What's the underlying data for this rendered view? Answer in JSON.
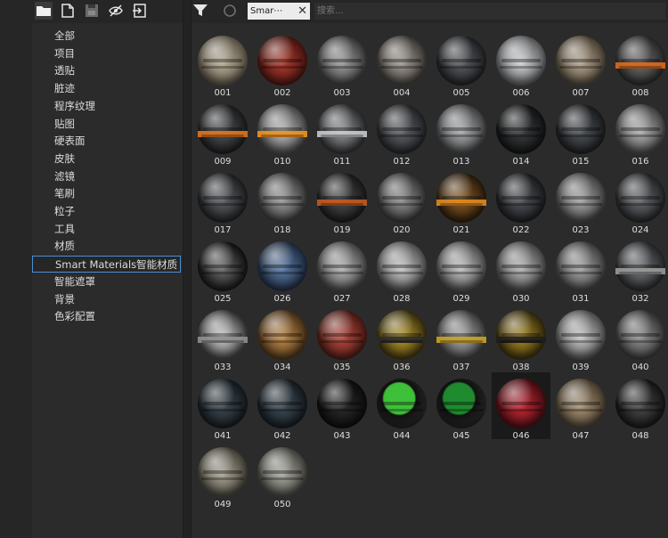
{
  "toolbar": {
    "icons": [
      "folder-icon",
      "new-file-icon",
      "save-icon",
      "hide-icon",
      "import-icon"
    ]
  },
  "sidebar": {
    "categories": [
      "全部",
      "项目",
      "透贴",
      "脏迹",
      "程序纹理",
      "贴图",
      "硬表面",
      "皮肤",
      "滤镜",
      "笔刷",
      "粒子",
      "工具",
      "材质",
      "Smart Materials智能材质",
      "智能遮罩",
      "背景",
      "色彩配置"
    ],
    "selected_index": 13
  },
  "topbar": {
    "filter_icon": "filter-icon",
    "reset_icon": "reset-icon",
    "tag_label": "Smar⋯",
    "tag_close": "✕",
    "search_placeholder": "搜索..."
  },
  "materials": [
    {
      "id": "001",
      "c1": "#b7ad96",
      "c2": "#5e5547"
    },
    {
      "id": "002",
      "c1": "#b03a2e",
      "c2": "#4a1510"
    },
    {
      "id": "003",
      "c1": "#9c9c9c",
      "c2": "#3d3d3d"
    },
    {
      "id": "004",
      "c1": "#a09a92",
      "c2": "#403c38"
    },
    {
      "id": "005",
      "c1": "#5a5d61",
      "c2": "#1f2123"
    },
    {
      "id": "006",
      "c1": "#cfd1d2",
      "c2": "#5b5d5f"
    },
    {
      "id": "007",
      "c1": "#b3a58f",
      "c2": "#4f4637"
    },
    {
      "id": "008",
      "c1": "#6a6a6a",
      "c2": "#2a2a2a",
      "stripe": "#d96a1e"
    },
    {
      "id": "009",
      "c1": "#4c4e51",
      "c2": "#1c1d1f",
      "stripe": "#e0761f"
    },
    {
      "id": "010",
      "c1": "#b9b9b9",
      "c2": "#4a4a4a",
      "stripe": "#f0921d"
    },
    {
      "id": "011",
      "c1": "#8e9093",
      "c2": "#2c2d2f",
      "stripe": "#c9c9c9"
    },
    {
      "id": "012",
      "c1": "#5e6166",
      "c2": "#222426"
    },
    {
      "id": "013",
      "c1": "#a9abad",
      "c2": "#434547"
    },
    {
      "id": "014",
      "c1": "#3a3c3e",
      "c2": "#121314"
    },
    {
      "id": "015",
      "c1": "#4f5358",
      "c2": "#1b1d1f"
    },
    {
      "id": "016",
      "c1": "#b1b1b1",
      "c2": "#474747"
    },
    {
      "id": "017",
      "c1": "#5c5e62",
      "c2": "#1f2022"
    },
    {
      "id": "018",
      "c1": "#9a9a9a",
      "c2": "#3b3b3b"
    },
    {
      "id": "019",
      "c1": "#4a4a4a",
      "c2": "#1a1a1a",
      "stripe": "#c45a22"
    },
    {
      "id": "020",
      "c1": "#8f8f8f",
      "c2": "#353535"
    },
    {
      "id": "021",
      "c1": "#8a5a22",
      "c2": "#2a1c0c",
      "stripe": "#e08a22"
    },
    {
      "id": "022",
      "c1": "#4e5257",
      "c2": "#1b1c1e"
    },
    {
      "id": "023",
      "c1": "#a7a7a7",
      "c2": "#444444"
    },
    {
      "id": "024",
      "c1": "#65686c",
      "c2": "#232426"
    },
    {
      "id": "025",
      "c1": "#6a6a6a",
      "c2": "#111111"
    },
    {
      "id": "026",
      "c1": "#5a7aa6",
      "c2": "#1e2c40"
    },
    {
      "id": "027",
      "c1": "#b3b3b3",
      "c2": "#4a4a4a"
    },
    {
      "id": "028",
      "c1": "#c6c6c6",
      "c2": "#545454"
    },
    {
      "id": "029",
      "c1": "#c0c0c0",
      "c2": "#505050"
    },
    {
      "id": "030",
      "c1": "#b5b5b5",
      "c2": "#4b4b4b"
    },
    {
      "id": "031",
      "c1": "#a4a4a4",
      "c2": "#424242"
    },
    {
      "id": "032",
      "c1": "#6e7176",
      "c2": "#26282a",
      "stripe": "#9a9a9a"
    },
    {
      "id": "033",
      "c1": "#d0d0d0",
      "c2": "#3a3a3a",
      "stripe": "#8f8f8f"
    },
    {
      "id": "034",
      "c1": "#c08a48",
      "c2": "#4a3218"
    },
    {
      "id": "035",
      "c1": "#b84a3e",
      "c2": "#4a1a14"
    },
    {
      "id": "036",
      "c1": "#b89a2a",
      "c2": "#3a300e",
      "stripe": "#2a2a2a"
    },
    {
      "id": "037",
      "c1": "#a8a8a8",
      "c2": "#3e3e3e",
      "stripe": "#c9a222"
    },
    {
      "id": "038",
      "c1": "#a88a22",
      "c2": "#352b0c",
      "stripe": "#1e1e1e"
    },
    {
      "id": "039",
      "c1": "#c8c8c8",
      "c2": "#535353"
    },
    {
      "id": "040",
      "c1": "#909090",
      "c2": "#363636"
    },
    {
      "id": "041",
      "c1": "#3e4a52",
      "c2": "#141a1e"
    },
    {
      "id": "042",
      "c1": "#3f4c55",
      "c2": "#141b20"
    },
    {
      "id": "043",
      "c1": "#2d2d2d",
      "c2": "#0c0c0c"
    },
    {
      "id": "044",
      "c1": "#2a2a2a",
      "c2": "#0c0c0c",
      "accent": "#3fc03a"
    },
    {
      "id": "045",
      "c1": "#2a2a2a",
      "c2": "#0c0c0c",
      "accent": "#1f8a2e"
    },
    {
      "id": "046",
      "c1": "#c22a36",
      "c2": "#4a0c12"
    },
    {
      "id": "047",
      "c1": "#a89478",
      "c2": "#4a3e2e"
    },
    {
      "id": "048",
      "c1": "#4a4a4a",
      "c2": "#151515"
    },
    {
      "id": "049",
      "c1": "#a9a493",
      "c2": "#46433a"
    },
    {
      "id": "050",
      "c1": "#a9a9a0",
      "c2": "#45453f"
    }
  ],
  "selected_material": "046"
}
